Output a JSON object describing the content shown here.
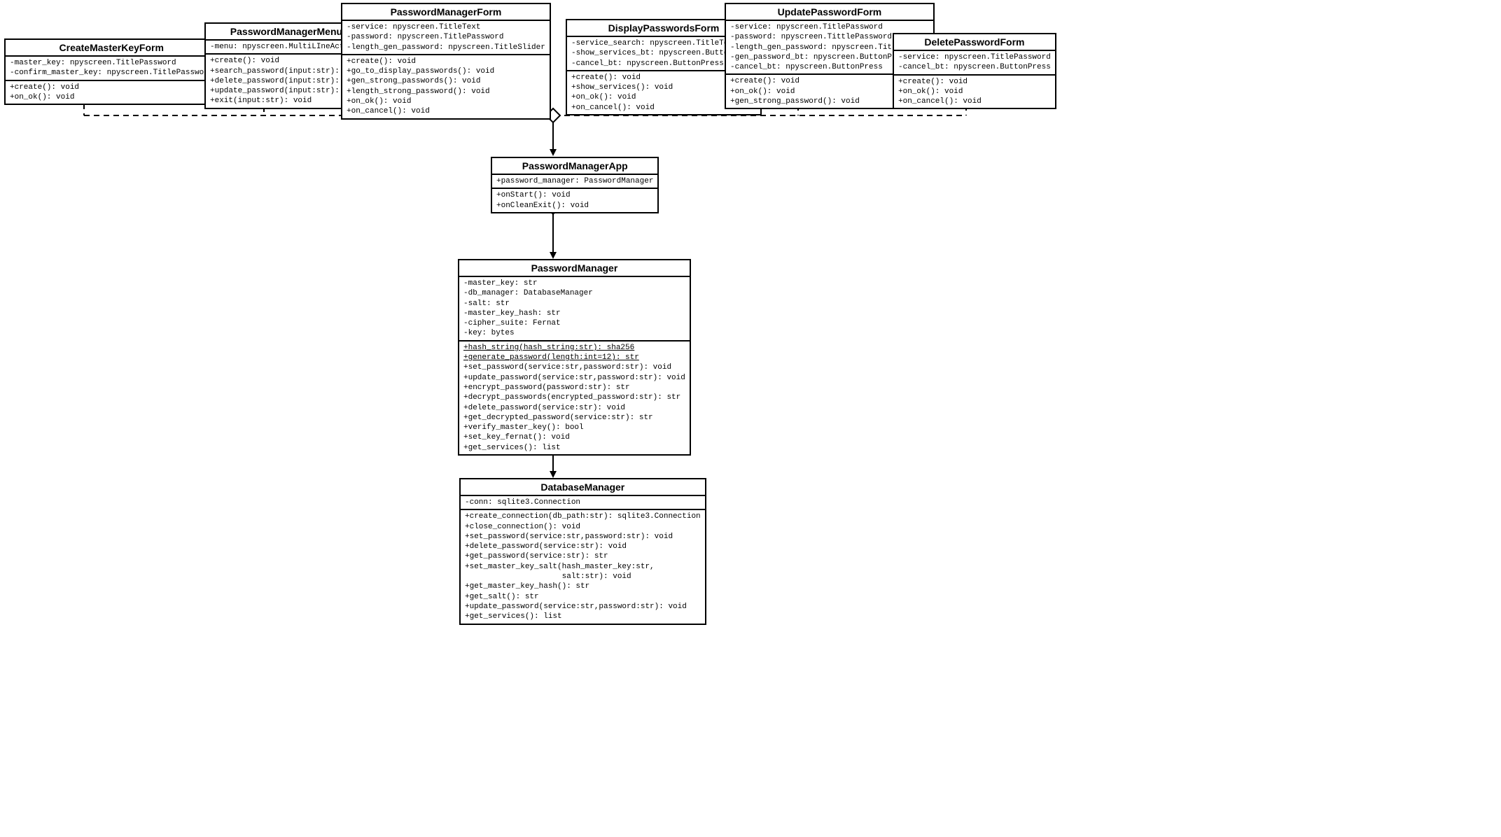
{
  "classes": {
    "createMasterKeyForm": {
      "title": "CreateMasterKeyForm",
      "attrs": [
        "-master_key: npyscreen.TitlePassword",
        "-confirm_master_key: npyscreen.TitlePassword"
      ],
      "methods": [
        "+create(): void",
        "+on_ok(): void"
      ]
    },
    "passwordManagerMenu": {
      "title": "PasswordManagerMenu",
      "attrs": [
        "-menu: npyscreen.MultiLIneAction"
      ],
      "methods": [
        "+create(): void",
        "+search_password(input:str): void",
        "+delete_password(input:str): void",
        "+update_password(input:str): void",
        "+exit(input:str): void"
      ]
    },
    "passwordManagerForm": {
      "title": "PasswordManagerForm",
      "attrs": [
        "-service: npyscreen.TitleText",
        "-password: npyscreen.TitlePassword",
        "-length_gen_password: npyscreen.TitleSlider"
      ],
      "methods": [
        "+create(): void",
        "+go_to_display_passwords(): void",
        "+gen_strong_passwords(): void",
        "+length_strong_password(): void",
        "+on_ok(): void",
        "+on_cancel(): void"
      ]
    },
    "displayPasswordsForm": {
      "title": "DisplayPasswordsForm",
      "attrs": [
        "-service_search: npyscreen.TitleText",
        "-show_services_bt: npyscreen.ButtonPress",
        "-cancel_bt: npyscreen.ButtonPress"
      ],
      "methods": [
        "+create(): void",
        "+show_services(): void",
        "+on_ok(): void",
        "+on_cancel(): void"
      ]
    },
    "updatePasswordForm": {
      "title": "UpdatePasswordForm",
      "attrs": [
        "-service: npyscreen.TitlePassword",
        "-password: npyscreen.TittlePassword",
        "-length_gen_password: npyscreen.TitleSlider",
        "-gen_password_bt: npyscreen.ButtonPress",
        "-cancel_bt: npyscreen.ButtonPress"
      ],
      "methods": [
        "+create(): void",
        "+on_ok(): void",
        "+gen_strong_password(): void"
      ]
    },
    "deletePasswordForm": {
      "title": "DeletePasswordForm",
      "attrs": [
        "-service: npyscreen.TitlePassword",
        "-cancel_bt: npyscreen.ButtonPress"
      ],
      "methods": [
        "+create(): void",
        "+on_ok(): void",
        "+on_cancel(): void"
      ]
    },
    "passwordManagerApp": {
      "title": "PasswordManagerApp",
      "attrs": [
        "+password_manager: PasswordManager"
      ],
      "methods": [
        "+onStart(): void",
        "+onCleanExit(): void"
      ]
    },
    "passwordManager": {
      "title": "PasswordManager",
      "attrs": [
        "-master_key: str",
        "-db_manager: DatabaseManager",
        "-salt: str",
        "-master_key_hash: str",
        "-cipher_suite: Fernat",
        "-key: bytes"
      ],
      "methodsUnderlined": [
        "+hash_string(hash_string:str): sha256",
        "+generate_password(length:int=12): str"
      ],
      "methods": [
        "+set_password(service:str,password:str): void",
        "+update_password(service:str,password:str): void",
        "+encrypt_password(password:str): str",
        "+decrypt_passwords(encrypted_password:str): str",
        "+delete_password(service:str): void",
        "+get_decrypted_password(service:str): str",
        "+verify_master_key(): bool",
        "+set_key_fernat(): void",
        "+get_services(): list"
      ]
    },
    "databaseManager": {
      "title": "DatabaseManager",
      "attrs": [
        "-conn: sqlite3.Connection"
      ],
      "methods": [
        "+create_connection(db_path:str): sqlite3.Connection",
        "+close_connection(): void",
        "+set_password(service:str,password:str): void",
        "+delete_password(service:str): void",
        "+get_password(service:str): str",
        "+set_master_key_salt(hash_master_key:str,",
        "                     salt:str): void",
        "+get_master_key_hash(): str",
        "+get_salt(): str",
        "+update_password(service:str,password:str): void",
        "+get_services(): list"
      ]
    }
  }
}
